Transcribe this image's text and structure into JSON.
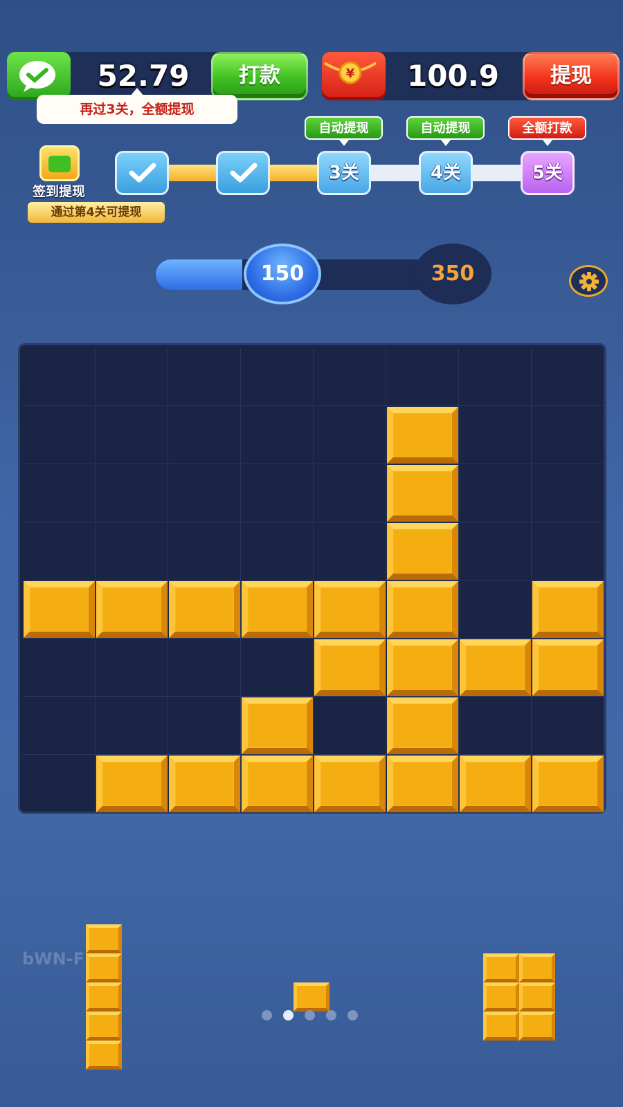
{
  "wallet": {
    "balance": "52.79",
    "button_label": "打款",
    "tip": "再过3关，全额提现",
    "icon": "wechat-icon",
    "accent": "#3fbf22"
  },
  "redpack": {
    "balance": "100.9",
    "button_label": "提现",
    "icon": "red-envelope-icon",
    "accent": "#f2331c"
  },
  "progress": {
    "signin_label": "签到提现",
    "signin_note": "通过第4关可提现",
    "steps": [
      {
        "label": "",
        "state": "done",
        "icon": "check-icon"
      },
      {
        "label": "",
        "state": "done",
        "icon": "check-icon"
      },
      {
        "label": "3关",
        "state": "pending",
        "tag": "自动提现"
      },
      {
        "label": "4关",
        "state": "pending",
        "tag": "自动提现"
      },
      {
        "label": "5关",
        "state": "final",
        "tag": "全额打款"
      }
    ]
  },
  "score": {
    "current": "150",
    "target": "350",
    "fraction": 0.43
  },
  "settings": {
    "icon": "gear-icon"
  },
  "board": {
    "columns": 8,
    "rows": 8,
    "filled": [
      [
        1,
        5
      ],
      [
        2,
        5
      ],
      [
        3,
        5
      ],
      [
        4,
        0
      ],
      [
        4,
        1
      ],
      [
        4,
        2
      ],
      [
        4,
        3
      ],
      [
        4,
        4
      ],
      [
        4,
        5
      ],
      [
        4,
        7
      ],
      [
        5,
        4
      ],
      [
        5,
        5
      ],
      [
        5,
        6
      ],
      [
        5,
        7
      ],
      [
        6,
        3
      ],
      [
        6,
        5
      ],
      [
        7,
        1
      ],
      [
        7,
        2
      ],
      [
        7,
        3
      ],
      [
        7,
        4
      ],
      [
        7,
        5
      ],
      [
        7,
        6
      ],
      [
        7,
        7
      ]
    ],
    "block_color": "#f4ae12",
    "empty_color": "#1a2444"
  },
  "pieces": [
    {
      "shape": "vertical-5"
    },
    {
      "shape": "single"
    },
    {
      "shape": "2x3"
    }
  ],
  "watermark": "bWN-Fb",
  "pager": {
    "count": 5,
    "active": 1
  }
}
